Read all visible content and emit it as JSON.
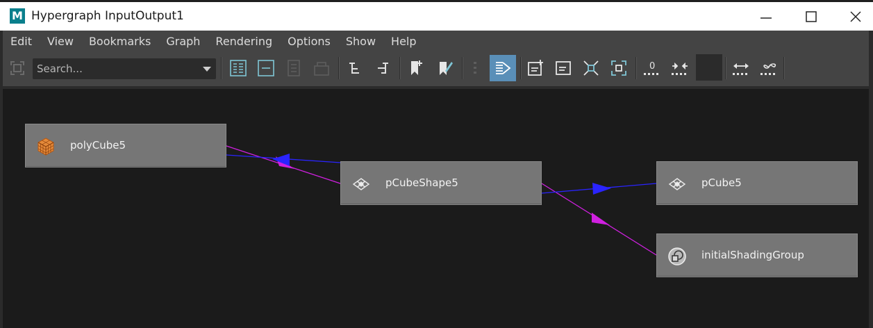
{
  "window": {
    "logo": "M",
    "title": "Hypergraph InputOutput1",
    "controls": [
      "minimize-icon",
      "maximize-icon",
      "close-icon"
    ]
  },
  "menu": {
    "items": [
      "Edit",
      "View",
      "Bookmarks",
      "Graph",
      "Rendering",
      "Options",
      "Show",
      "Help"
    ]
  },
  "toolbar": {
    "search_placeholder": "Search...",
    "buttons": [
      "frame-icon",
      "grid-layout-icon",
      "collapse-icon",
      "page-icon",
      "stack-icon",
      "tree-down-icon",
      "tree-left-icon",
      "bookmark-add-icon",
      "bookmark-edit-icon",
      "dotted-bar-icon",
      "input-output-icon",
      "container-add-icon",
      "container-icon",
      "frame-selected-icon",
      "frame-all-icon",
      "zero-dots-icon",
      "collapse-arrows-icon",
      "color-swatch",
      "expand-arrows-icon",
      "infinity-dots-icon"
    ],
    "active_button": "input-output-icon"
  },
  "graph": {
    "nodes": [
      {
        "label": "polyCube5",
        "icon": "poly-cube-icon"
      },
      {
        "label": "pCubeShape5",
        "icon": "mesh-shape-icon"
      },
      {
        "label": "pCube5",
        "icon": "transform-icon"
      },
      {
        "label": "initialShadingGroup",
        "icon": "shading-group-icon"
      }
    ],
    "colors": {
      "input_edge": "#2a24ff",
      "output_edge": "#d020e0",
      "node_fill": "#767676",
      "canvas": "#1b1b1b",
      "active_tool": "#5a8fb8"
    }
  }
}
